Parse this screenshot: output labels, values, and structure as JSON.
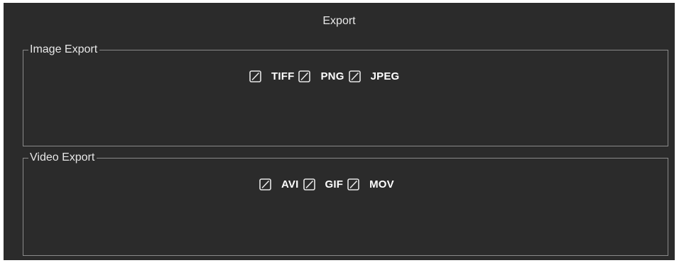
{
  "dialog": {
    "title": "Export"
  },
  "image_export": {
    "label": "Image Export",
    "options": [
      {
        "label": "TIFF",
        "checked": false
      },
      {
        "label": "PNG",
        "checked": false
      },
      {
        "label": "JPEG",
        "checked": false
      }
    ]
  },
  "video_export": {
    "label": "Video Export",
    "options": [
      {
        "label": "AVI",
        "checked": false
      },
      {
        "label": "GIF",
        "checked": false
      },
      {
        "label": "MOV",
        "checked": false
      }
    ]
  },
  "colors": {
    "background": "#2b2b2b",
    "border": "#8a8a8a",
    "text": "#ffffff"
  }
}
